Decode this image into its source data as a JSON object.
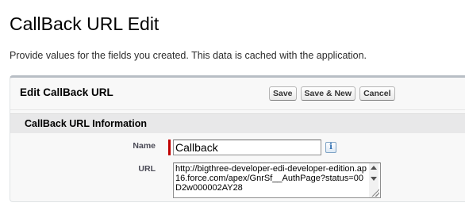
{
  "page": {
    "title": "CallBack URL Edit",
    "intro": "Provide values for the fields you created. This data is cached with the application."
  },
  "panel": {
    "title": "Edit CallBack URL",
    "buttons": {
      "save": "Save",
      "save_new": "Save & New",
      "cancel": "Cancel"
    },
    "section_title": "CallBack URL Information",
    "fields": {
      "name": {
        "label": "Name",
        "value": "Callback",
        "required": true,
        "info_icon": "i"
      },
      "url": {
        "label": "URL",
        "value": "http://bigthree-developer-edi-developer-edition.ap16.force.com/apex/GnrSf__AuthPage?status=00D2w000002AY28"
      }
    }
  },
  "colors": {
    "required": "#c00000",
    "panel_border_top": "#b8bec5",
    "section_bg": "#e8e8e9"
  }
}
